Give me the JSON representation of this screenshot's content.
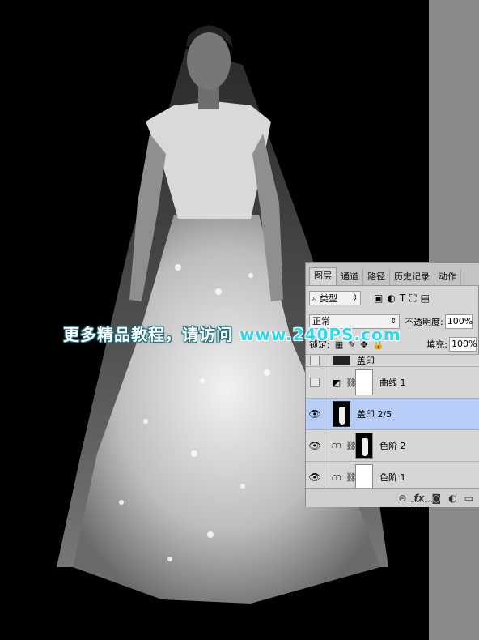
{
  "watermark": {
    "text": "更多精品教程，请访问",
    "url": "www.240PS.com"
  },
  "panel": {
    "tabs": [
      "图层",
      "通道",
      "路径",
      "历史记录",
      "动作"
    ],
    "filter": {
      "label": "类型",
      "search_icon": "search-icon"
    },
    "blend_mode": "正常",
    "opacity_label": "不透明度:",
    "opacity_value": "100%",
    "lock_label": "锁定:",
    "fill_label": "填充:",
    "fill_value": "100%",
    "layers": [
      {
        "name": "盖印",
        "visible": false,
        "partial": true
      },
      {
        "name": "曲线 1",
        "visible": false,
        "type": "curves-adjustment"
      },
      {
        "name": "盖印 2/5",
        "visible": true,
        "selected": true
      },
      {
        "name": "色阶 2",
        "visible": true,
        "type": "levels-adjustment"
      },
      {
        "name": "色阶 1",
        "visible": true,
        "type": "levels-adjustment"
      }
    ],
    "footer_icons": [
      "link-icon",
      "fx-icon",
      "mask-icon",
      "adjustment-icon",
      "folder-icon"
    ]
  }
}
